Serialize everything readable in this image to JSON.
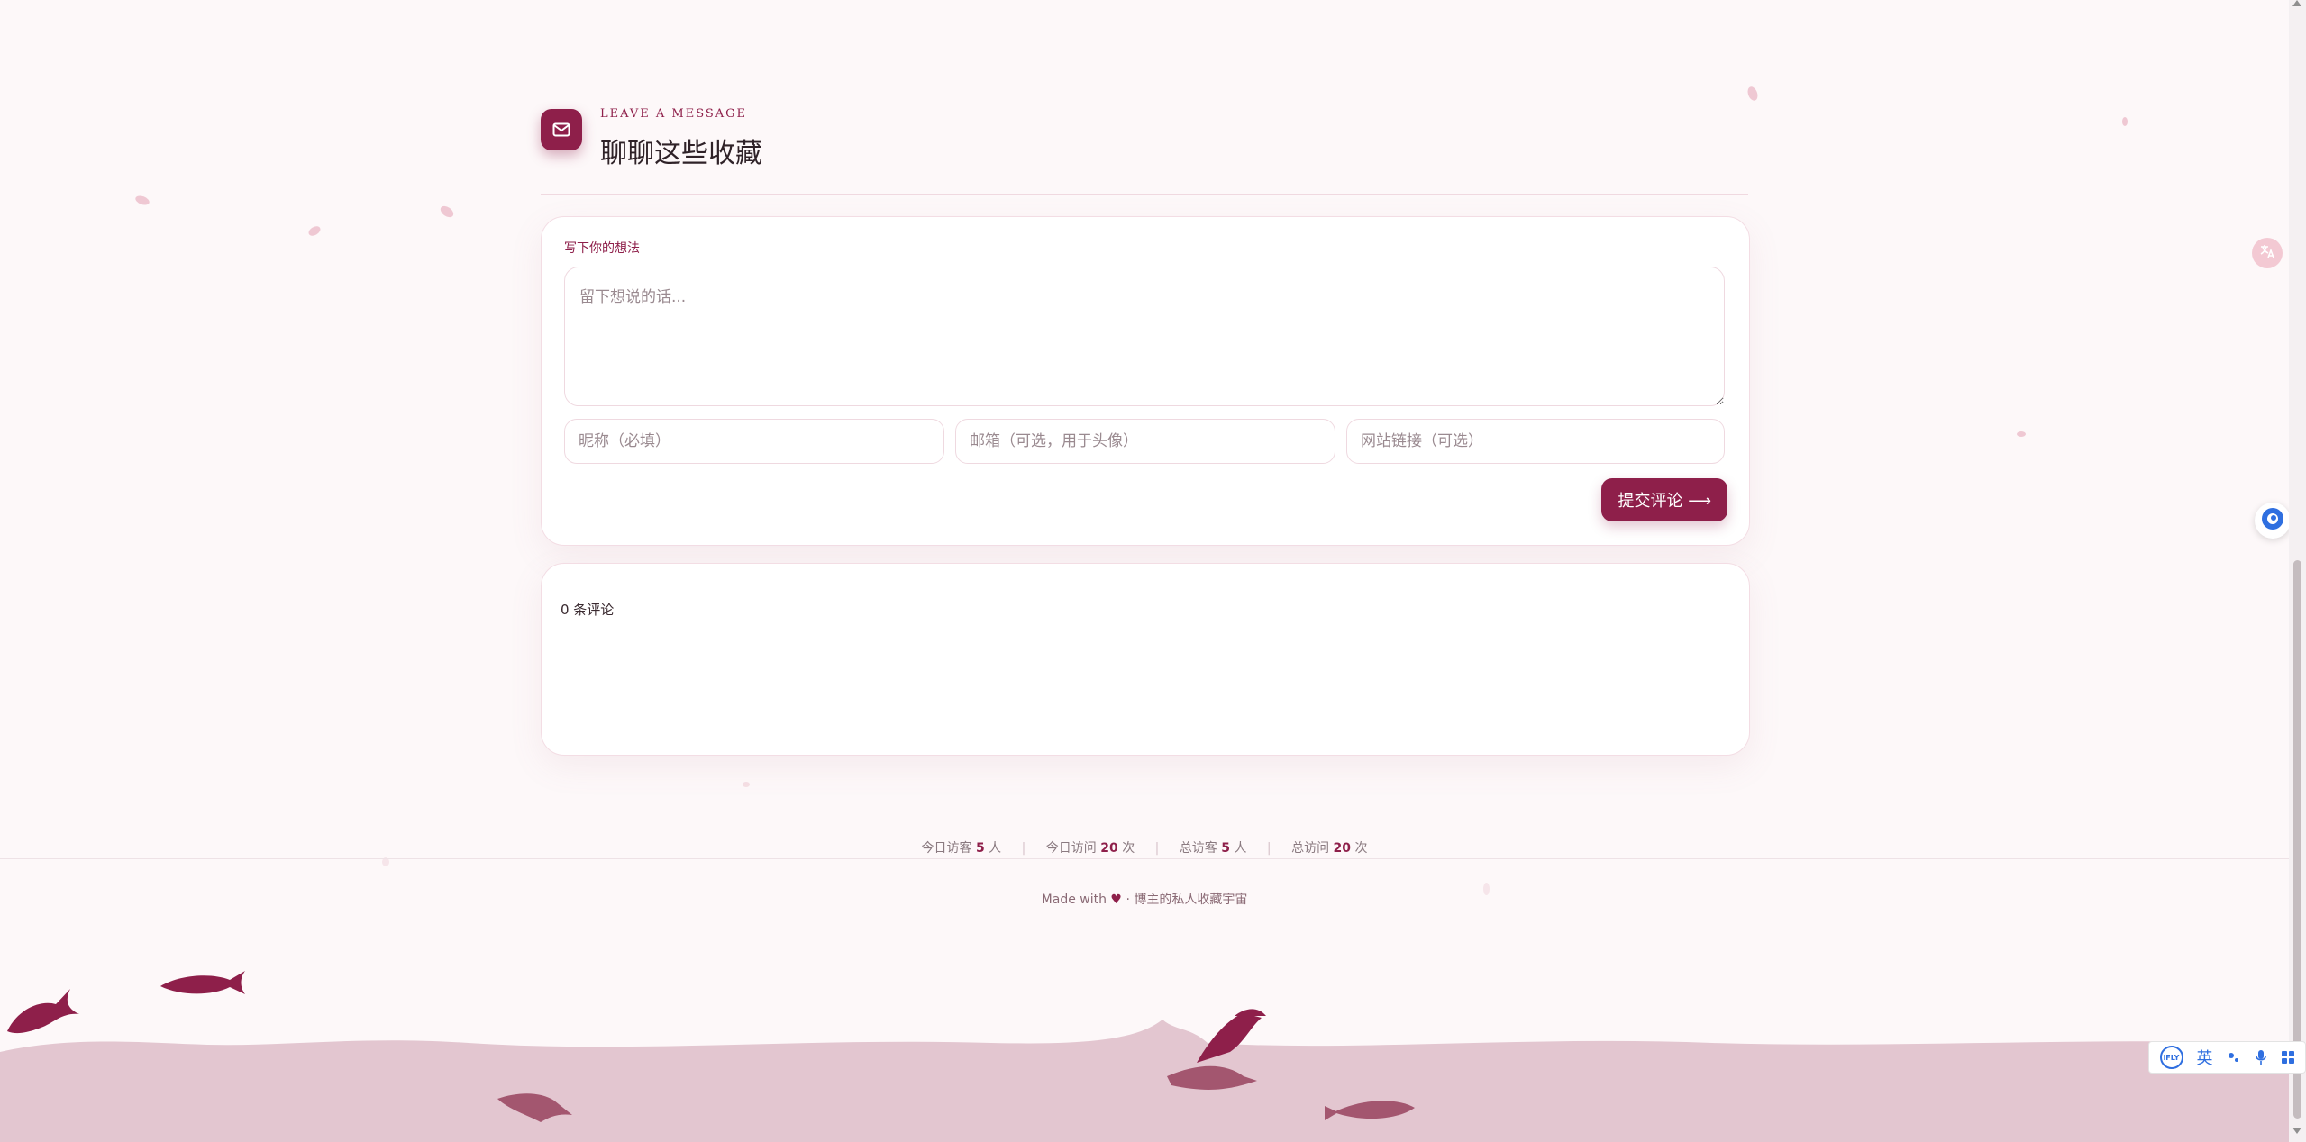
{
  "section": {
    "kicker": "LEAVE A MESSAGE",
    "title": "聊聊这些收藏"
  },
  "form": {
    "label": "写下你的想法",
    "message_placeholder": "留下想说的话...",
    "nickname_placeholder": "昵称（必填）",
    "email_placeholder": "邮箱（可选，用于头像）",
    "website_placeholder": "网站链接（可选）",
    "submit_label": "提交评论 ⟶"
  },
  "comments": {
    "count_label": "0 条评论"
  },
  "stats": {
    "today_visitors_label": "今日访客",
    "today_visitors_value": "5",
    "today_visitors_unit": "人",
    "today_visits_label": "今日访问",
    "today_visits_value": "20",
    "today_visits_unit": "次",
    "total_visitors_label": "总访客",
    "total_visitors_value": "5",
    "total_visitors_unit": "人",
    "total_visits_label": "总访问",
    "total_visits_value": "20",
    "total_visits_unit": "次"
  },
  "footer": {
    "made_with": "Made with",
    "heart": "♥",
    "separator": "·",
    "site_name": "博主的私人收藏宇宙"
  },
  "ime": {
    "logo": "iFLY",
    "mode": "英"
  },
  "colors": {
    "accent": "#8e1f4a",
    "background": "#fdf8f9",
    "sea": "#e3c6d0",
    "fish": "#8e1f4a"
  },
  "icons": [
    "mail-icon",
    "translate-icon",
    "chat-bubble-icon",
    "microphone-icon",
    "grid-apps-icon",
    "punctuation-icon",
    "fish-icon"
  ]
}
